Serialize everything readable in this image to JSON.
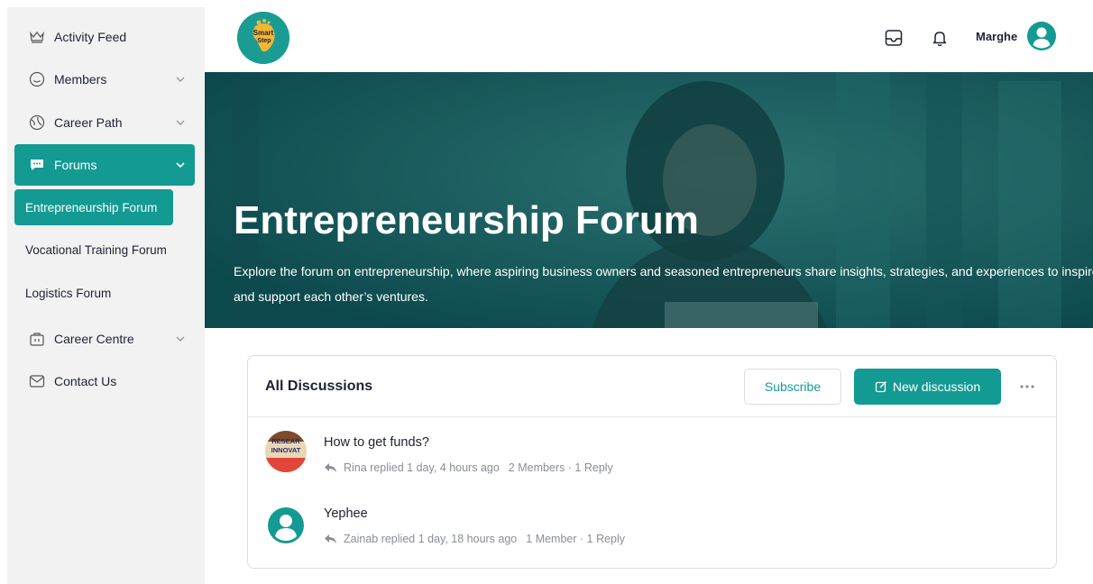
{
  "sidebar": {
    "items": [
      {
        "label": "Activity Feed",
        "icon": "crown-icon"
      },
      {
        "label": "Members",
        "icon": "smiley-icon"
      },
      {
        "label": "Career Path",
        "icon": "globe-icon"
      },
      {
        "label": "Forums",
        "icon": "chat-icon"
      },
      {
        "label": "Career Centre",
        "icon": "briefcase-icon"
      },
      {
        "label": "Contact Us",
        "icon": "mail-icon"
      }
    ],
    "forums_sub": [
      {
        "label": "Entrepreneurship Forum"
      },
      {
        "label": "Vocational Training Forum"
      },
      {
        "label": "Logistics Forum"
      }
    ]
  },
  "header": {
    "logo_text_1": "Smart",
    "logo_text_2": "Step",
    "user_name": "Marghe"
  },
  "hero": {
    "title": "Entrepreneurship Forum",
    "description": "Explore the forum on entrepreneurship, where aspiring business owners and seasoned entrepreneurs share insights, strategies, and experiences to inspire and support each other’s ventures."
  },
  "discussions": {
    "title": "All Discussions",
    "subscribe_label": "Subscribe",
    "new_label": "New discussion",
    "threads": [
      {
        "title": "How to get funds?",
        "reply": "Rina replied 1 day, 4 hours ago",
        "stats": "2 Members · 1 Reply",
        "avatar_text_1": "RESEAR",
        "avatar_text_2": "INNOVAT"
      },
      {
        "title": "Yephee",
        "reply": "Zainab replied 1 day, 18 hours ago",
        "stats": "1 Member · 1 Reply"
      }
    ]
  },
  "colors": {
    "accent": "#139a93",
    "sidebar_bg": "#f2f2f2",
    "text": "#1e2132",
    "muted": "#8a8d99"
  }
}
